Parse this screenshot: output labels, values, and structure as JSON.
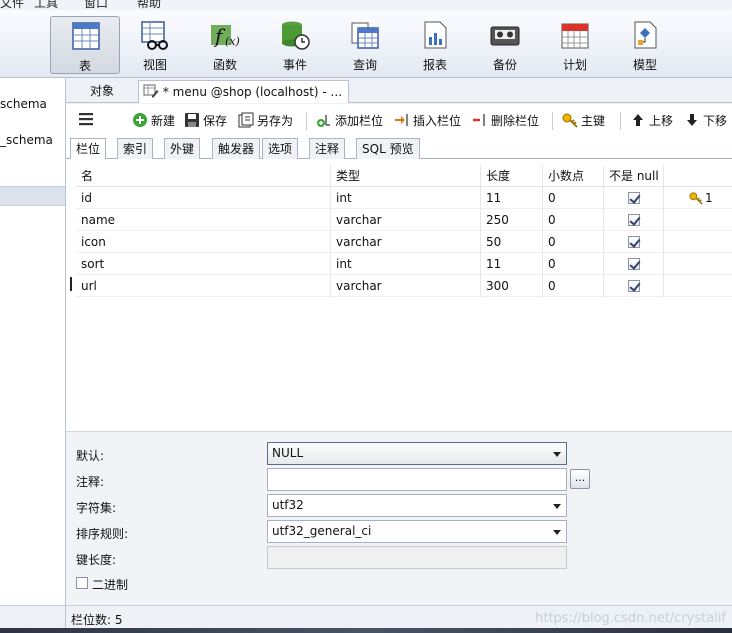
{
  "menubar": {
    "items": [
      "文件",
      "工具",
      "窗口",
      "帮助"
    ]
  },
  "ribbon": {
    "buttons": [
      {
        "label": "表",
        "icon": "table-icon",
        "active": true
      },
      {
        "label": "视图",
        "icon": "view-icon"
      },
      {
        "label": "函数",
        "icon": "function-icon"
      },
      {
        "label": "事件",
        "icon": "event-icon"
      },
      {
        "label": "查询",
        "icon": "query-icon"
      },
      {
        "label": "报表",
        "icon": "report-icon"
      },
      {
        "label": "备份",
        "icon": "backup-icon"
      },
      {
        "label": "计划",
        "icon": "schedule-icon"
      },
      {
        "label": "模型",
        "icon": "model-icon"
      }
    ]
  },
  "sidebar": {
    "items": [
      "schema",
      "_schema"
    ]
  },
  "doctabs": {
    "objects": "对象",
    "active": "* menu @shop (localhost) - ..."
  },
  "toolbar": {
    "new": "新建",
    "save": "保存",
    "save_as": "另存为",
    "add_field": "添加栏位",
    "insert_field": "插入栏位",
    "delete_field": "删除栏位",
    "primary_key": "主键",
    "move_up": "上移",
    "move_down": "下移"
  },
  "subtabs": [
    "栏位",
    "索引",
    "外键",
    "触发器",
    "选项",
    "注释",
    "SQL 预览"
  ],
  "grid": {
    "headers": {
      "name": "名",
      "type": "类型",
      "length": "长度",
      "decimals": "小数点",
      "not_null": "不是 null"
    },
    "rows": [
      {
        "name": "id",
        "type": "int",
        "length": "11",
        "decimals": "0",
        "not_null": true,
        "key": "1"
      },
      {
        "name": "name",
        "type": "varchar",
        "length": "250",
        "decimals": "0",
        "not_null": true,
        "key": ""
      },
      {
        "name": "icon",
        "type": "varchar",
        "length": "50",
        "decimals": "0",
        "not_null": true,
        "key": ""
      },
      {
        "name": "sort",
        "type": "int",
        "length": "11",
        "decimals": "0",
        "not_null": true,
        "key": ""
      },
      {
        "name": "url",
        "type": "varchar",
        "length": "300",
        "decimals": "0",
        "not_null": true,
        "key": ""
      }
    ]
  },
  "props": {
    "default_label": "默认:",
    "default_value": "NULL",
    "comment_label": "注释:",
    "comment_value": "",
    "ellipsis": "...",
    "charset_label": "字符集:",
    "charset_value": "utf32",
    "collation_label": "排序规则:",
    "collation_value": "utf32_general_ci",
    "keylen_label": "键长度:",
    "keylen_value": "",
    "binary_label": "二进制"
  },
  "status": {
    "count": "栏位数: 5",
    "watermark": "https://blog.csdn.net/crystalif"
  }
}
